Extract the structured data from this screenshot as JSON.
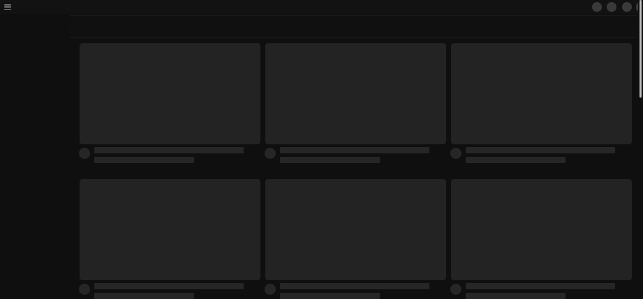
{
  "theme": {
    "background": "#0f0f0f",
    "skeleton": "#232323",
    "scrollbar_thumb": "#bdbdbd"
  },
  "header": {
    "menu_icon": "hamburger-menu-icon",
    "action_placeholders": 4
  },
  "feed": {
    "state": "loading-skeleton",
    "rows": 2,
    "columns": 3
  }
}
